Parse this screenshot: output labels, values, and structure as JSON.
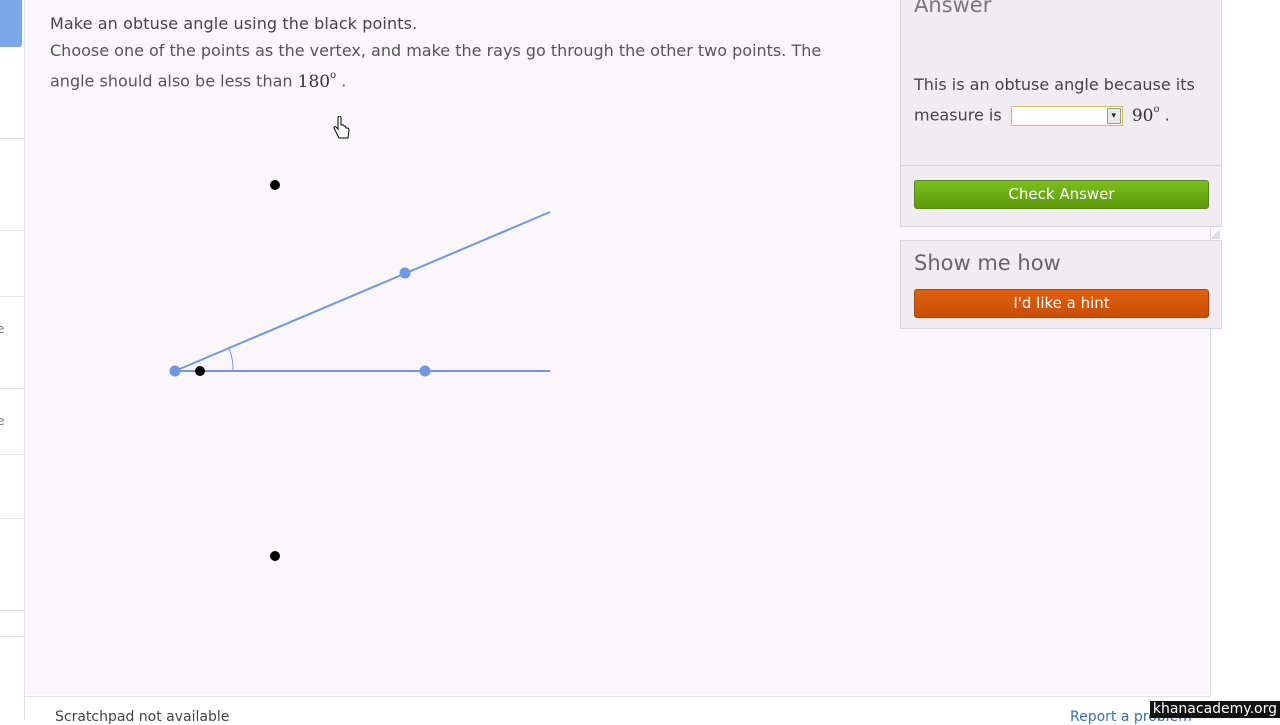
{
  "prompt": {
    "title": "Make an obtuse angle using the black points.",
    "body_part1": "Choose one of the points as the vertex, and make the rays go through the other two points. The angle should also be less than",
    "body_math_value": "180",
    "body_math_sup": "o",
    "body_end": "."
  },
  "answer": {
    "heading": "Answer",
    "text_before": "This is an obtuse angle because its measure is",
    "select_value": "",
    "math_value": "90",
    "math_sup": "o",
    "text_end": "."
  },
  "check_button_label": "Check Answer",
  "hint": {
    "heading": "Show me how",
    "button_label": "I'd like a hint"
  },
  "footer": {
    "scratchpad": "Scratchpad not available",
    "report": "Report a problem"
  },
  "watermark": "khanacademy.org",
  "colors": {
    "ray": "#6f98e2",
    "black_point": "#000000",
    "check_green": "#6aad14",
    "hint_orange": "#d65a09",
    "card_bg": "#fbf6fb"
  },
  "left_strip": {
    "glyphs": [
      "e",
      "e"
    ]
  }
}
